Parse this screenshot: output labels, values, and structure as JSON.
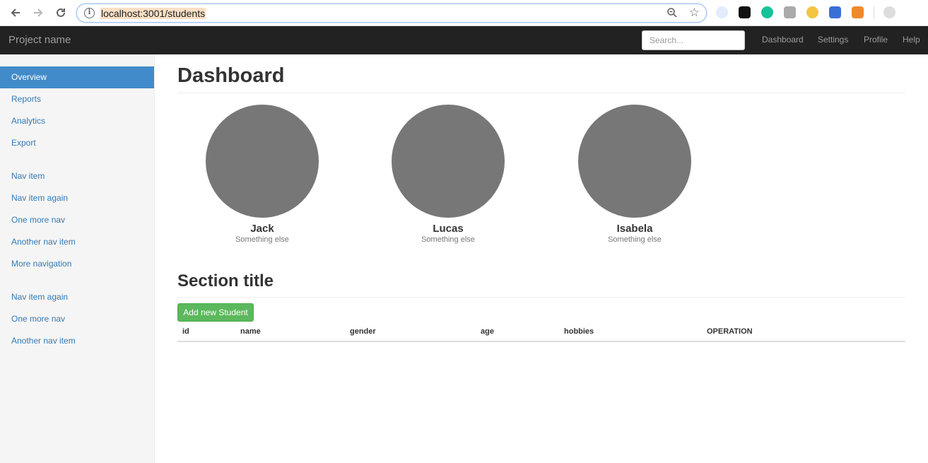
{
  "browser": {
    "url": "localhost:3001/students",
    "icons": [
      "back-icon",
      "forward-icon",
      "reload-icon",
      "info-icon",
      "zoom-icon",
      "star-icon"
    ]
  },
  "navbar": {
    "brand": "Project name",
    "search_placeholder": "Search...",
    "links": [
      "Dashboard",
      "Settings",
      "Profile",
      "Help"
    ]
  },
  "sidebar": {
    "group1": [
      "Overview",
      "Reports",
      "Analytics",
      "Export"
    ],
    "group2": [
      "Nav item",
      "Nav item again",
      "One more nav",
      "Another nav item",
      "More navigation"
    ],
    "group3": [
      "Nav item again",
      "One more nav",
      "Another nav item"
    ],
    "active": "Overview"
  },
  "main": {
    "title": "Dashboard",
    "people": [
      {
        "name": "Jack",
        "subtitle": "Something else"
      },
      {
        "name": "Lucas",
        "subtitle": "Something else"
      },
      {
        "name": "Isabela",
        "subtitle": "Something else"
      }
    ],
    "section_title": "Section title",
    "add_button": "Add new Student",
    "table_headers": [
      "id",
      "name",
      "gender",
      "age",
      "hobbies",
      "OPERATION"
    ]
  },
  "colors": {
    "navbar_bg": "#222222",
    "active_nav": "#428bca",
    "link": "#337ab7",
    "success_button": "#5cb85c",
    "avatar_placeholder": "#777777"
  }
}
